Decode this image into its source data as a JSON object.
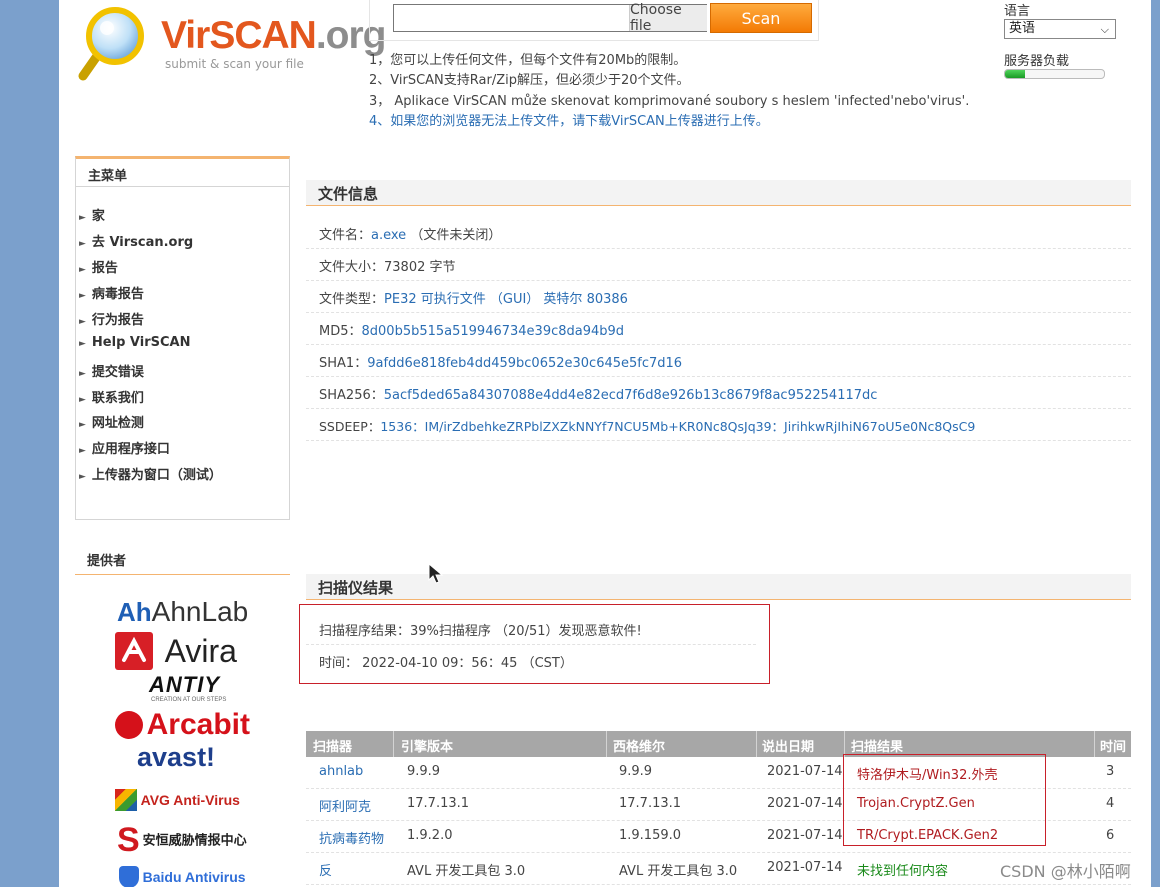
{
  "header": {
    "brand_main": "VirSCAN",
    "brand_tld": ".org",
    "tagline": "submit & scan your file"
  },
  "upload": {
    "choose_label": "Choose file",
    "scan_label": "Scan",
    "notices": [
      "1，您可以上传任何文件，但每个文件有20Mb的限制。",
      "2、VirSCAN支持Rar/Zip解压，但必须少于20个文件。",
      "3， Aplikace VirSCAN může skenovat komprimované soubory s heslem 'infected'nebo'virus'.",
      "4、如果您的浏览器无法上传文件，请下载VirSCAN上传器进行上传。"
    ]
  },
  "language": {
    "label": "语言",
    "selected": "英语",
    "load_label": "服务器负载",
    "load_fraction": 0.2
  },
  "sidebar": {
    "menu_title": "主菜单",
    "items": [
      "家",
      "去 Virscan.org",
      "报告",
      "病毒报告",
      "行为报告",
      "Help VirSCAN",
      "提交错误",
      "联系我们",
      "网址检测",
      "应用程序接口",
      "上传器为窗口（测试）"
    ],
    "providers_title": "提供者",
    "providers": {
      "ahnlab": "AhnLab",
      "avira": "Avira",
      "antiy": "ANTIY",
      "antiy_sub": "CREATION AT OUR STEPS",
      "arcabit": "Arcabit",
      "avast": "avast!",
      "avg": "AVG Anti-Virus",
      "anheng": "安恒威胁情报中心",
      "baidu": "Baidu Antivirus"
    }
  },
  "file_info": {
    "title": "文件信息",
    "rows": [
      {
        "label": "文件名：",
        "value": "a.exe",
        "extra": " （文件未关闭）"
      },
      {
        "label": "文件大小：",
        "value": "",
        "extra": "73802 字节"
      },
      {
        "label": "文件类型：",
        "value": "PE32 可执行文件 （GUI） 英特尔 80386",
        "extra": ""
      },
      {
        "label": "MD5：",
        "value": "8d00b5b515a519946734e39c8da94b9d",
        "extra": ""
      },
      {
        "label": "SHA1：",
        "value": "9afdd6e818feb4dd459bc0652e30c645e5fc7d16",
        "extra": ""
      },
      {
        "label": "SHA256：",
        "value": "5acf5ded65a84307088e4dd4e82ecd7f6d8e926b13c8679f8ac952254117dc",
        "extra": ""
      },
      {
        "label": "SSDEEP：",
        "value": "1536：IM/irZdbehkeZRPblZXZkNNYf7NCU5Mb+KR0Nc8QsJq39：JirihkwRjIhiN67oU5e0Nc8QsC9",
        "extra": ""
      }
    ]
  },
  "scan_summary": {
    "title": "扫描仪结果",
    "result": "扫描程序结果：39%扫描程序 （20/51）发现恶意软件!",
    "time": "时间： 2022-04-10 09：56：45 （CST）"
  },
  "results_table": {
    "headers": [
      "扫描器",
      "引擎版本",
      "西格维尔",
      "说出日期",
      "扫描结果",
      "时间"
    ],
    "rows": [
      {
        "engine": "ahnlab",
        "version": "9.9.9",
        "sig": "9.9.9",
        "date": "2021-07-14",
        "result": "特洛伊木马/Win32.外壳",
        "status": "mal",
        "time": "3"
      },
      {
        "engine": "阿利阿克",
        "version": "17.7.13.1",
        "sig": "17.7.13.1",
        "date": "2021-07-14",
        "result": "Trojan.CryptZ.Gen",
        "status": "mal",
        "time": "4"
      },
      {
        "engine": "抗病毒药物",
        "version": "1.9.2.0",
        "sig": "1.9.159.0",
        "date": "2021-07-14",
        "result": "TR/Crypt.EPACK.Gen2",
        "status": "mal",
        "time": "6"
      },
      {
        "engine": "反",
        "version": "AVL 开发工具包 3.0",
        "sig": "AVL 开发工具包 3.0",
        "date": "2021-07-14",
        "result": "未找到任何内容",
        "status": "clean",
        "time": ""
      }
    ]
  },
  "watermark": "CSDN @林小陌啊"
}
